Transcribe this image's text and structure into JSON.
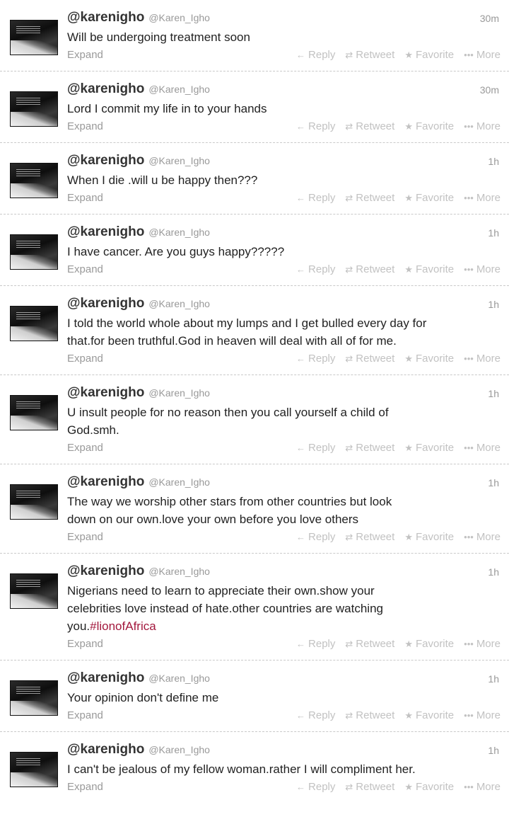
{
  "actions": {
    "expand": "Expand",
    "reply": "Reply",
    "retweet": "Retweet",
    "favorite": "Favorite",
    "more": "More"
  },
  "icons": {
    "reply": "reply-arrow-icon",
    "retweet": "retweet-arrows-icon",
    "favorite": "star-icon",
    "more": "ellipsis-icon"
  },
  "colors": {
    "hashtag": "#a3183d",
    "muted": "#999999"
  },
  "tweets": [
    {
      "username": "@karenigho",
      "handle": "@Karen_Igho",
      "time": "30m",
      "lines": [
        "Will be undergoing treatment soon"
      ]
    },
    {
      "username": "@karenigho",
      "handle": "@Karen_Igho",
      "time": "30m",
      "lines": [
        "Lord I commit my life in to your hands"
      ]
    },
    {
      "username": "@karenigho",
      "handle": "@Karen_Igho",
      "time": "1h",
      "lines": [
        "When I die .will u be happy then???"
      ]
    },
    {
      "username": "@karenigho",
      "handle": "@Karen_Igho",
      "time": "1h",
      "lines": [
        "I have cancer. Are you guys happy?????"
      ]
    },
    {
      "username": "@karenigho",
      "handle": "@Karen_Igho",
      "time": "1h",
      "lines": [
        "I told the world whole about my lumps and I get bulled every day for",
        "that.for been truthful.God in heaven will deal with all of for me."
      ]
    },
    {
      "username": "@karenigho",
      "handle": "@Karen_Igho",
      "time": "1h",
      "lines": [
        "U insult people for no reason then you call yourself a child of",
        "God.smh."
      ]
    },
    {
      "username": "@karenigho",
      "handle": "@Karen_Igho",
      "time": "1h",
      "lines": [
        "The way we worship other stars from other countries but look",
        "down on our own.love your own before you love others"
      ]
    },
    {
      "username": "@karenigho",
      "handle": "@Karen_Igho",
      "time": "1h",
      "lines": [
        "Nigerians need to learn to appreciate their own.show your",
        "celebrities love instead of hate.other countries are watching"
      ],
      "last_line_prefix": "you.",
      "hashtag": "#lionofAfrica"
    },
    {
      "username": "@karenigho",
      "handle": "@Karen_Igho",
      "time": "1h",
      "lines": [
        "Your opinion don't define me"
      ]
    },
    {
      "username": "@karenigho",
      "handle": "@Karen_Igho",
      "time": "1h",
      "lines": [
        "I can't be jealous of my fellow woman.rather I will compliment her."
      ]
    }
  ]
}
